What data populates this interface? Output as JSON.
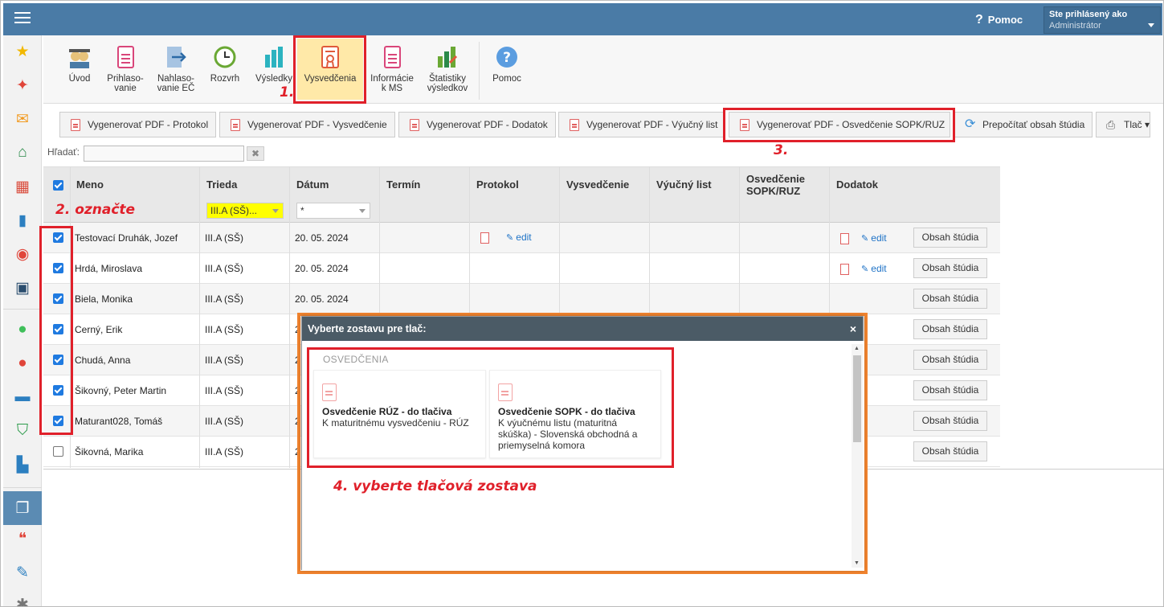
{
  "topbar": {
    "help_label": "Pomoc",
    "user_line1": "Ste prihlásený ako",
    "user_line2": "Administrátor"
  },
  "toolbar": {
    "items": [
      {
        "label": "Úvod",
        "icon": "students-icon"
      },
      {
        "label": "Prihlaso-\nvanie",
        "icon": "form-icon"
      },
      {
        "label": "Nahlaso-\nvanie EČ",
        "icon": "arrow-export-icon"
      },
      {
        "label": "Rozvrh",
        "icon": "clock-icon"
      },
      {
        "label": "Výsledky",
        "icon": "bar-chart-icon"
      },
      {
        "label": "Vysvedčenia",
        "icon": "certificate-icon"
      },
      {
        "label": "Informácie\nk MS",
        "icon": "info-doc-icon"
      },
      {
        "label": "Štatistiky\nvýsledkov",
        "icon": "stats-icon"
      },
      {
        "label": "Pomoc",
        "icon": "help-icon"
      }
    ]
  },
  "actions": {
    "btn1": "Vygenerovať PDF - Protokol",
    "btn2": "Vygenerovať PDF - Vysvedčenie",
    "btn3": "Vygenerovať PDF - Dodatok",
    "btn4": "Vygenerovať PDF - Výučný list",
    "btn5": "Vygenerovať PDF - Osvedčenie SOPK/RUZ",
    "btn6": "Prepočítať obsah štúdia",
    "btn7": "Tlač ▾"
  },
  "search": {
    "label": "Hľadať:",
    "value": ""
  },
  "grid": {
    "headers": {
      "meno": "Meno",
      "trieda": "Trieda",
      "datum": "Dátum",
      "termin": "Termín",
      "protokol": "Protokol",
      "vysvedcenie": "Vysvedčenie",
      "vyucny": "Výučný list",
      "osv1": "Osvedčenie",
      "osv2": "SOPK/RUZ",
      "dodatok": "Dodatok"
    },
    "filter_trieda": "III.A (SŠ)...",
    "filter_datum": "*",
    "edit_label": "edit",
    "obsah_label": "Obsah štúdia",
    "rows": [
      {
        "meno": "Testovací Druhák, Jozef",
        "trieda": "III.A (SŠ)",
        "datum": "20. 05. 2024",
        "checked": true
      },
      {
        "meno": "Hrdá, Miroslava",
        "trieda": "III.A (SŠ)",
        "datum": "20. 05. 2024",
        "checked": true
      },
      {
        "meno": "Biela, Monika",
        "trieda": "III.A (SŠ)",
        "datum": "20. 05. 2024",
        "checked": true
      },
      {
        "meno": "Cerný, Erik",
        "trieda": "III.A (SŠ)",
        "datum": "2",
        "checked": true
      },
      {
        "meno": "Chudá, Anna",
        "trieda": "III.A (SŠ)",
        "datum": "2",
        "checked": true
      },
      {
        "meno": "Šikovný, Peter Martin",
        "trieda": "III.A (SŠ)",
        "datum": "2",
        "checked": true
      },
      {
        "meno": "Maturant028, Tomáš",
        "trieda": "III.A (SŠ)",
        "datum": "2",
        "checked": true
      },
      {
        "meno": "Šikovná, Marika",
        "trieda": "III.A (SŠ)",
        "datum": "2",
        "checked": false
      }
    ]
  },
  "dialog": {
    "title": "Vyberte zostavu pre tlač:",
    "close": "×",
    "section": "OSVEDČENIA",
    "card1_title": "Osvedčenie RÚZ - do tlačiva",
    "card1_desc": "K maturitnému vysvedčeniu - RÚZ",
    "card2_title": "Osvedčenie SOPK - do tlačiva",
    "card2_desc": "K výučnému listu (maturitná skúška) - Slovenská obchodná a priemyselná komora"
  },
  "annotations": {
    "a1": "1.",
    "a2": "2. označte",
    "a3": "3.",
    "a4": "4. vyberte tlačová zostava"
  },
  "colors": {
    "topbar": "#4a7ba6",
    "annotation": "#e0202a",
    "highlight": "#ffe9a8",
    "orange": "#f0832e",
    "filter_yellow": "#ffff00"
  }
}
